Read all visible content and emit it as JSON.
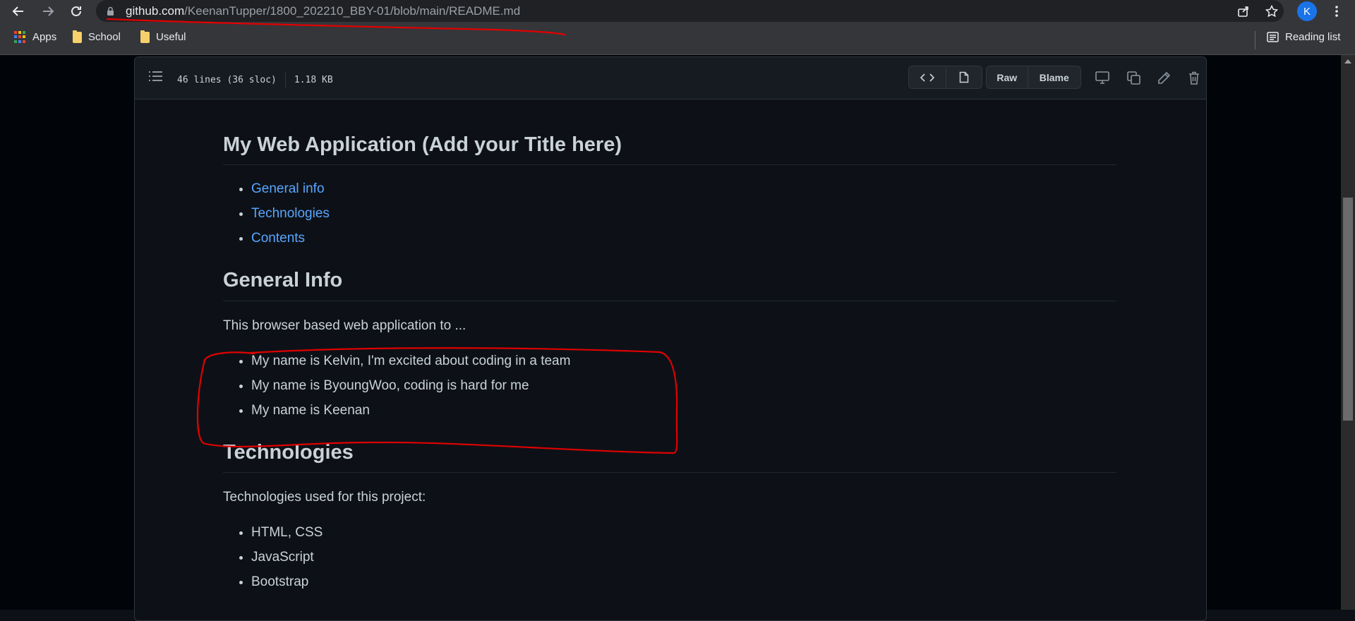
{
  "browser": {
    "url_host": "github.com",
    "url_path": "/KeenanTupper/1800_202210_BBY-01/blob/main/README.md",
    "profile_initial": "K",
    "bookmarks": [
      {
        "label": "Apps",
        "icon": "apps-grid-icon"
      },
      {
        "label": "School",
        "icon": "folder-icon"
      },
      {
        "label": "Useful",
        "icon": "folder-icon"
      }
    ],
    "reading_list": "Reading list"
  },
  "file_header": {
    "lines": "46 lines (36 sloc)",
    "size": "1.18 KB",
    "raw_label": "Raw",
    "blame_label": "Blame"
  },
  "readme": {
    "title": "My Web Application (Add your Title here)",
    "toc": [
      "General info",
      "Technologies",
      "Contents"
    ],
    "general_info_heading": "General Info",
    "general_info_text": "This browser based web application to ...",
    "members": [
      "My name is Kelvin, I'm excited about coding in a team",
      "My name is ByoungWoo, coding is hard for me",
      "My name is Keenan"
    ],
    "technologies_heading": "Technologies",
    "technologies_text": "Technologies used for this project:",
    "technologies": [
      "HTML, CSS",
      "JavaScript",
      "Bootstrap"
    ]
  },
  "colors": {
    "link": "#58a6ff",
    "annotation": "#e00000",
    "avatar": "#1a73e8"
  }
}
